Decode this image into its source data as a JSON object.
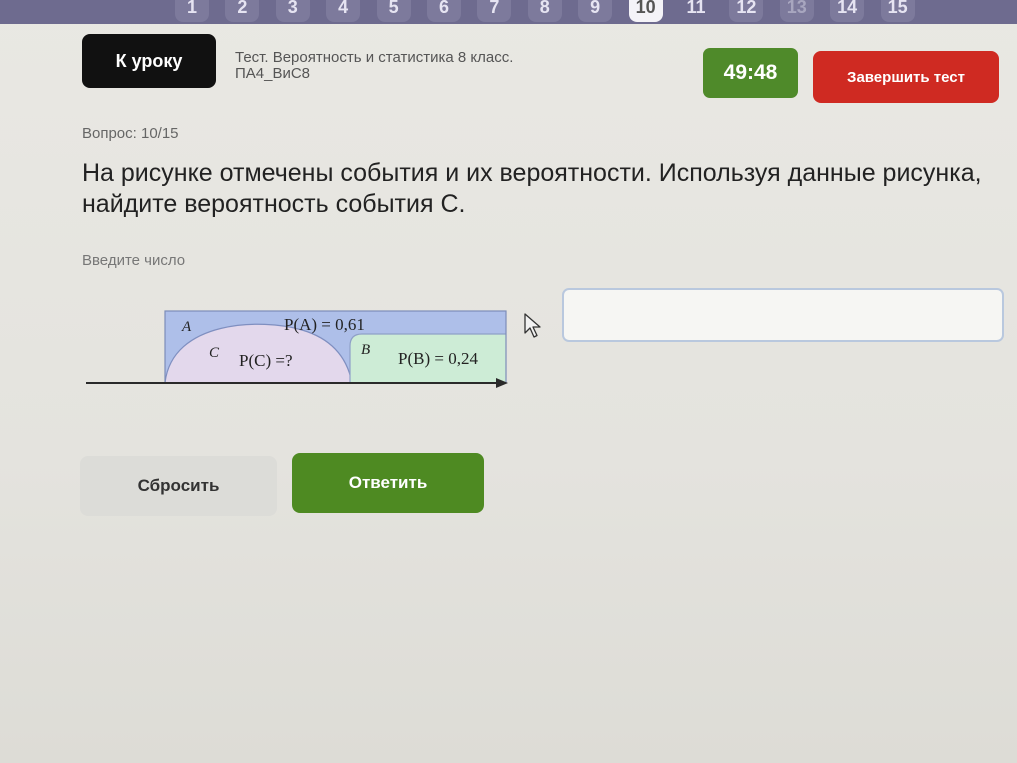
{
  "nav": {
    "questions": [
      {
        "label": "1",
        "state": "normal"
      },
      {
        "label": "2",
        "state": "normal"
      },
      {
        "label": "3",
        "state": "normal"
      },
      {
        "label": "4",
        "state": "normal"
      },
      {
        "label": "5",
        "state": "normal"
      },
      {
        "label": "6",
        "state": "normal"
      },
      {
        "label": "7",
        "state": "normal"
      },
      {
        "label": "8",
        "state": "normal"
      },
      {
        "label": "9",
        "state": "normal"
      },
      {
        "label": "10",
        "state": "current"
      },
      {
        "label": "11",
        "state": "plain"
      },
      {
        "label": "12",
        "state": "normal"
      },
      {
        "label": "13",
        "state": "dim"
      },
      {
        "label": "14",
        "state": "normal"
      },
      {
        "label": "15",
        "state": "normal"
      }
    ]
  },
  "header": {
    "back_label": "К уроку",
    "test_title_line1": "Тест. Вероятность и статистика 8 класс.",
    "test_title_line2": "ПА4_ВиС8",
    "timer": "49:48",
    "finish_label": "Завершить тест"
  },
  "question": {
    "counter": "Вопрос: 10/15",
    "text": "На рисунке отмечены события и их вероятности. Используя данные рисунка, найдите вероятность события C.",
    "hint": "Введите число"
  },
  "figure": {
    "label_a": "A",
    "prob_a": "P(A) = 0,61",
    "label_c": "C",
    "prob_c": "P(C) =?",
    "label_b": "B",
    "prob_b": "P(B) = 0,24",
    "color_a": "#aebfe9",
    "color_c": "#e3d8ec",
    "color_b": "#cdecd6"
  },
  "answer": {
    "value": "",
    "placeholder": ""
  },
  "actions": {
    "reset_label": "Сбросить",
    "submit_label": "Ответить"
  },
  "colors": {
    "timer_bg": "#4f8a2a",
    "finish_bg": "#cf2a22",
    "submit_bg": "#4e8a22",
    "nav_bg": "#6e6b8f"
  }
}
